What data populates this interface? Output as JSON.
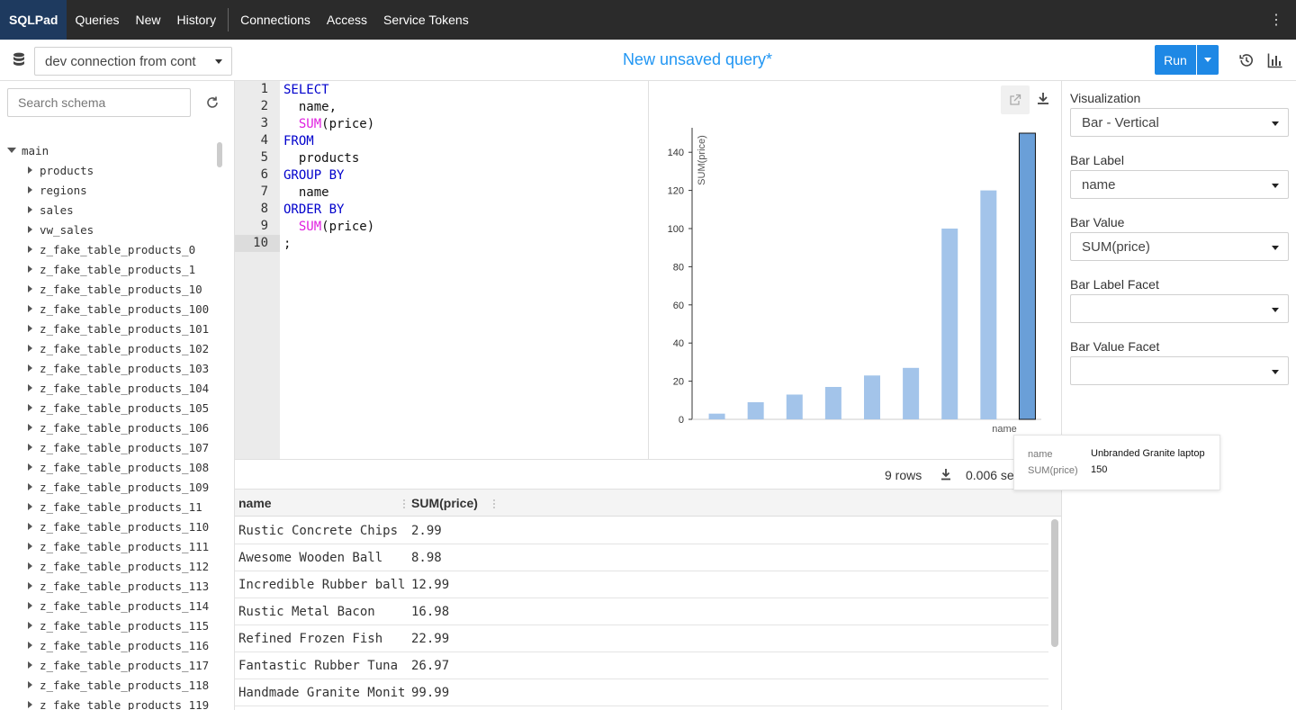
{
  "nav": {
    "brand": "SQLPad",
    "items": [
      "Queries",
      "New",
      "History"
    ],
    "items2": [
      "Connections",
      "Access",
      "Service Tokens"
    ]
  },
  "toolbar": {
    "connection": "dev connection from cont",
    "title": "New unsaved query*",
    "run_label": "Run"
  },
  "schema": {
    "search_placeholder": "Search schema",
    "root": "main",
    "tables": [
      "products",
      "regions",
      "sales",
      "vw_sales",
      "z_fake_table_products_0",
      "z_fake_table_products_1",
      "z_fake_table_products_10",
      "z_fake_table_products_100",
      "z_fake_table_products_101",
      "z_fake_table_products_102",
      "z_fake_table_products_103",
      "z_fake_table_products_104",
      "z_fake_table_products_105",
      "z_fake_table_products_106",
      "z_fake_table_products_107",
      "z_fake_table_products_108",
      "z_fake_table_products_109",
      "z_fake_table_products_11",
      "z_fake_table_products_110",
      "z_fake_table_products_111",
      "z_fake_table_products_112",
      "z_fake_table_products_113",
      "z_fake_table_products_114",
      "z_fake_table_products_115",
      "z_fake_table_products_116",
      "z_fake_table_products_117",
      "z_fake_table_products_118",
      "z_fake_table_products_119"
    ]
  },
  "editor": {
    "lines": [
      [
        {
          "t": "SELECT",
          "k": "kw"
        }
      ],
      [
        {
          "t": "  name,",
          "k": ""
        }
      ],
      [
        {
          "t": "  ",
          "k": ""
        },
        {
          "t": "SUM",
          "k": "fn"
        },
        {
          "t": "(price)",
          "k": ""
        }
      ],
      [
        {
          "t": "FROM",
          "k": "kw"
        }
      ],
      [
        {
          "t": "  products",
          "k": ""
        }
      ],
      [
        {
          "t": "GROUP BY",
          "k": "kw"
        }
      ],
      [
        {
          "t": "  name",
          "k": ""
        }
      ],
      [
        {
          "t": "ORDER BY",
          "k": "kw"
        }
      ],
      [
        {
          "t": "  ",
          "k": ""
        },
        {
          "t": "SUM",
          "k": "fn"
        },
        {
          "t": "(price)",
          "k": ""
        }
      ],
      [
        {
          "t": ";",
          "k": ""
        }
      ]
    ],
    "active_line": 10
  },
  "chart_data": {
    "type": "bar",
    "categories": [
      "Rustic Concrete Chips",
      "Awesome Wooden Ball",
      "Incredible Rubber ball",
      "Rustic Metal Bacon",
      "Refined Frozen Fish",
      "Fantastic Rubber Tuna",
      "Handmade Granite Monit",
      "",
      "Unbranded Granite laptop"
    ],
    "values": [
      2.99,
      8.98,
      12.99,
      16.98,
      22.99,
      26.97,
      99.99,
      120,
      150
    ],
    "xlabel": "name",
    "ylabel": "SUM(price)",
    "ylim": [
      0,
      150
    ],
    "yticks": [
      0,
      20,
      40,
      60,
      80,
      100,
      120,
      140
    ],
    "highlight_index": 8,
    "bar_color": "#a3c4ea",
    "highlight_color": "#6a9fd8"
  },
  "tooltip": {
    "label_key": "name",
    "label_value": "Unbranded Granite laptop",
    "value_key": "SUM(price)",
    "value_value": "150"
  },
  "viz": {
    "fields": [
      {
        "label": "Visualization",
        "value": "Bar - Vertical"
      },
      {
        "label": "Bar Label",
        "value": "name"
      },
      {
        "label": "Bar Value",
        "value": "SUM(price)"
      },
      {
        "label": "Bar Label Facet",
        "value": ""
      },
      {
        "label": "Bar Value Facet",
        "value": ""
      }
    ]
  },
  "results": {
    "rows_text": "9 rows",
    "time_text": "0.006 se",
    "columns": [
      "name",
      "SUM(price)"
    ],
    "rows": [
      [
        "Rustic Concrete Chips",
        "2.99"
      ],
      [
        "Awesome Wooden Ball",
        "8.98"
      ],
      [
        "Incredible Rubber ball",
        "12.99"
      ],
      [
        "Rustic Metal Bacon",
        "16.98"
      ],
      [
        "Refined Frozen Fish",
        "22.99"
      ],
      [
        "Fantastic Rubber Tuna",
        "26.97"
      ],
      [
        "Handmade Granite Monit",
        "99.99"
      ]
    ]
  },
  "colors": {
    "accent": "#2196f3",
    "run_button": "#1e88e5",
    "topbar": "#2b2b2b",
    "brand_bg": "#1e3a5f",
    "keyword": "#0000cc",
    "function": "#e020e0"
  }
}
